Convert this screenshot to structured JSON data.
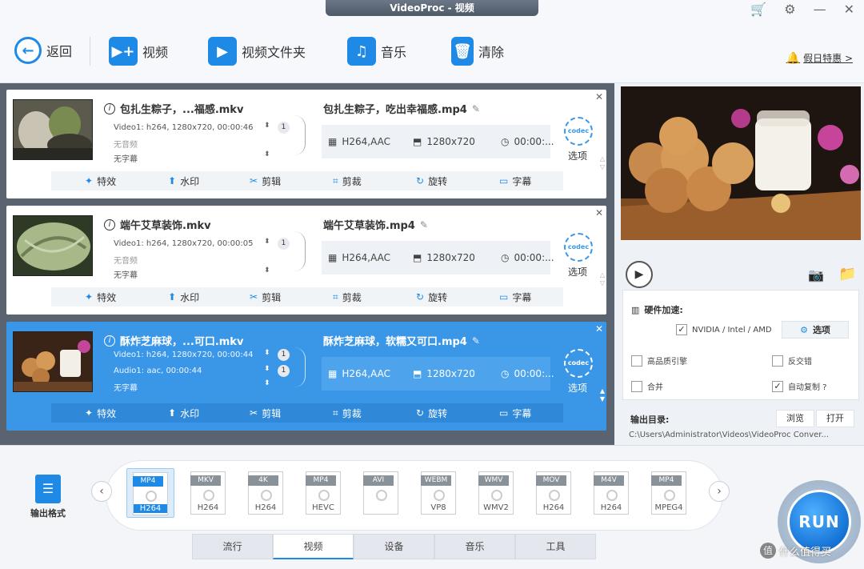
{
  "window": {
    "title": "VideoProc - 视频"
  },
  "toolbar": {
    "back": "返回",
    "video": "视频",
    "video_folder": "视频文件夹",
    "music": "音乐",
    "clear": "清除",
    "promo": "假日特惠 >"
  },
  "items": [
    {
      "src_title": "包扎生粽子，...福感.mkv",
      "video_meta": "Video1: h264, 1280x720, 00:00:46",
      "audio_meta": "无音频",
      "sub_meta": "无字幕",
      "track_count": "1",
      "dst_title": "包扎生粽子，吃出幸福感.mp4",
      "codec": "H264,AAC",
      "res": "1280x720",
      "duration": "00:00:..."
    },
    {
      "src_title": "端午艾草装饰.mkv",
      "video_meta": "Video1: h264, 1280x720, 00:00:05",
      "audio_meta": "无音频",
      "sub_meta": "无字幕",
      "track_count": "1",
      "dst_title": "端午艾草装饰.mp4",
      "codec": "H264,AAC",
      "res": "1280x720",
      "duration": "00:00:..."
    },
    {
      "src_title": "酥炸芝麻球，...可口.mkv",
      "video_meta": "Video1: h264, 1280x720, 00:00:44",
      "audio_meta": "Audio1: aac, 00:00:44",
      "sub_meta": "无字幕",
      "track_count": "1",
      "audio_count": "1",
      "dst_title": "酥炸芝麻球，软糯又可口.mp4",
      "codec": "H264,AAC",
      "res": "1280x720",
      "duration": "00:00:..."
    }
  ],
  "actions": {
    "effects": "特效",
    "watermark": "水印",
    "cut": "剪辑",
    "crop": "剪裁",
    "rotate": "旋转",
    "subtitle": "字幕"
  },
  "codec_label": "选项",
  "codec_icon_text": "codec",
  "options": {
    "hw_title": "硬件加速:",
    "hw_vendor": "NVIDIA / Intel / AMD",
    "options_btn": "选项",
    "hq_engine": "高品质引擎",
    "deinterlace": "反交错",
    "merge": "合并",
    "auto_copy": "自动复制 ?",
    "output_dir_label": "输出目录:",
    "browse": "浏览",
    "open": "打开",
    "output_path": "C:\\Users\\Administrator\\Videos\\VideoProc Conver..."
  },
  "formats": {
    "out_label": "输出格式",
    "list": [
      {
        "top": "MP4",
        "bottom": "H264",
        "selected": true
      },
      {
        "top": "MKV",
        "bottom": "H264"
      },
      {
        "top": "4K",
        "bottom": "H264"
      },
      {
        "top": "MP4",
        "bottom": "HEVC"
      },
      {
        "top": "AVI",
        "bottom": ""
      },
      {
        "top": "WEBM",
        "bottom": "VP8"
      },
      {
        "top": "WMV",
        "bottom": "WMV2"
      },
      {
        "top": "MOV",
        "bottom": "H264"
      },
      {
        "top": "M4V",
        "bottom": "H264"
      },
      {
        "top": "MP4",
        "bottom": "MPEG4"
      }
    ]
  },
  "tabs": [
    "流行",
    "视频",
    "设备",
    "音乐",
    "工具"
  ],
  "run": "RUN",
  "watermark": {
    "badge": "值",
    "text": "什么值得买"
  }
}
